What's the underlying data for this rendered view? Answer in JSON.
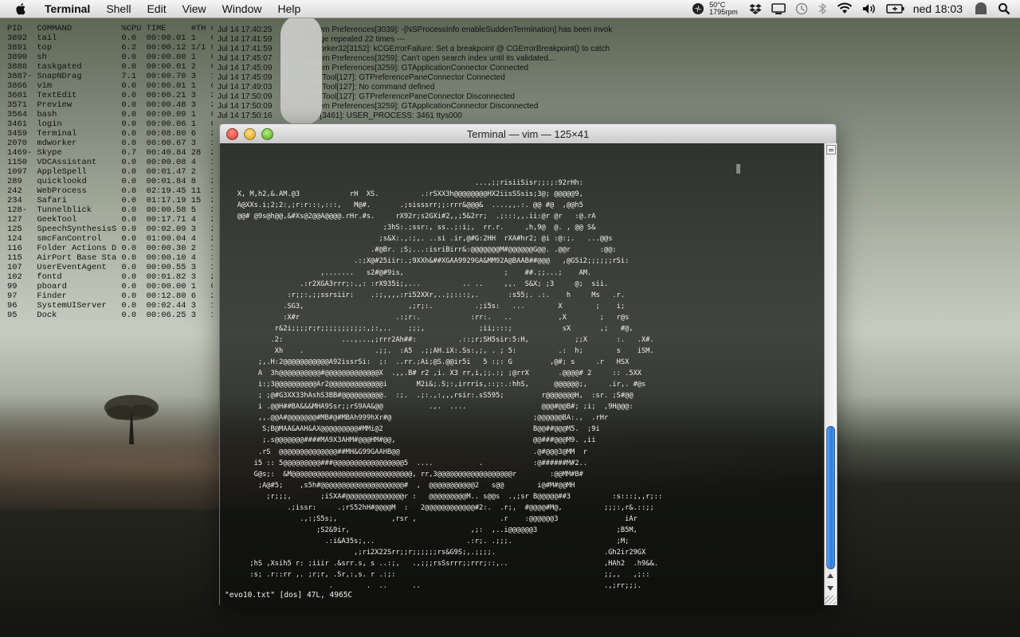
{
  "menubar": {
    "app_name": "Terminal",
    "items": [
      "Shell",
      "Edit",
      "View",
      "Window",
      "Help"
    ],
    "temp": "50°C",
    "rpm": "1795rpm",
    "clock": "ned 18:03",
    "icons": [
      "apple-icon",
      "cooling-icon",
      "dropbox-icon",
      "display-icon",
      "time-machine-icon",
      "bluetooth-icon",
      "wifi-icon",
      "volume-icon",
      "battery-icon",
      "user-icon",
      "spotlight-icon"
    ]
  },
  "process_list": {
    "text": "PID   COMMAND          %CPU TIME     #TH #WQ #POR\n3892  tail             0.0  00:00.01 1   0   14    22   1\n3891  top              6.2  00:00.12 1/1 0   25+   36+\n3890  sh               0.0  00:00.00 1   0   14    23   2\n3888  taskgated        0.0  00:00.01 2   0   25    27\n3887- SnapNDrag        7.1  00:00.70 3   1   101   1\n3866  vim              0.0  00:00.01 1   0   17    36\n3601  TextEdit         0.0  00:00.21 3   2   103   102\n3571  Preview          0.0  00:00.48 3   2   106   166\n3564  bash             0.0  00:00.09 1   0   17    24\n3461  login            0.0  00:00.06 1   0   22    56\n3459  Terminal         0.0  00:08.80 6   2   113   175\n2070  mdworker         0.0  00:00.67 3   1   50    83\n1469- Skype            0.7  00:40.84 28  2   427   793\n1150  VDCAssistant     0.0  00:00.08 4   1   90    74\n1097  AppleSpell       0.0  00:01.47 2   1   41    58\n289   quicklookd       0.0  00:01.84 8   2   102   155\n242   WebProcess       0.0  02:19.45 11  2   202   19\n234   Safari           0.0  01:17.19 15  2   288   827\n128-  Tunnelblick      0.0  00:00.58 5   2   107   12\n127   GeekTool         0.0  00:17.71 4   2   130   180\n125   SpeechSynthesisS 0.0  00:02.09 3   2   142   1\n124   smcFanControl    0.0  01:00.04 4   2   116   1\n116   Folder Actions D 0.0  00:00.30 2   1   67    80\n115   AirPort Base Sta 0.0  00:00.10 4   1   83    87\n107   UserEventAgent   0.0  00:00.55 3   1   181   1\n102   fontd            0.0  00:01.82 3   2   89    127\n99    pboard           0.0  00:00.00 1   0   22    39\n97    Finder           0.0  00:12.80 6   2   186   407\n96    SystemUIServer   0.0  00:02.44 3   1   248-  28\n95    Dock             0.0  00:06.25 3   1   135-  409-"
  },
  "console_log": {
    "text": "Jul 14 17:40:25              System Preferences[3039]: -[NSProcessInfo enableSuddenTermination] has been invok\nJul 14 17:41:59              essage repeated 22 times ---\nJul 14 17:41:59              mdworker32[3152]: kCGErrorFailure: Set a breakpoint @ CGErrorBreakpoint() to catch\nJul 14 17:45:07              System Preferences[3259]: Can't open search index until its validated...\nJul 14 17:45:09              System Preferences[3259]: GTApplicationConnector Connected\nJul 14 17:45:09              GeekTool[127]: GTPreferencePaneConnector Connected\nJul 14 17:49:03              GeekTool[127]: No command defined\nJul 14 17:50:09              GeekTool[127]: GTPreferencePaneConnector Disconnected\nJul 14 17:50:09              System Preferences[3259]: GTApplicationConnector Disconnected\nJul 14 17:50:16              login[3461]: USER_PROCESS: 3461 ttys000"
  },
  "terminal": {
    "title": "Terminal — vim — 125×41",
    "ascii_art": "                                                            ...,;;risiiSisr;;:;:92rHh:\n   X, M,h2,&.AM.@3            rH  XS.          .:rSXX3h@@@@@@@@HX2iisSSsis;3@; @@@@@9,\n   A@XXs.i;2;2:,;r:r:::,:::,   M@#.       .;sisssrr;;:rrr&@@@&  ....,,.:. @@ #@  ,@@h5\n   @@# @9s@h@@,&#Xs@2@@A@@@@.rHr.#s.     rX92r;s2GXi#2,,;5&2rr;  .;:::,,.ii:@r @r   :@.rA\n                                      ;3hS:.;ssr:, ss..;:i;,  rr.r.     ,h,9@  @. , @@ S&\n                                     ;s&X:.,:;,. ..si .ir,@#G:2HH  rXA#hr2; @i :@:;.   ...@@s\n                                   .#@Br. ;S;...:isriBirr&:@@@@@@@M#@@@@@@G@@. .@@r       :@@:\n                               .:;X@#25iir:.;9XXh&##XGAA9929GA&MM92A@BAAB##@@@   ,@GSi2;;;;;;rSi:\n                       ,.......   s2#@#9is,                        ;    ##.;;...;    AM.\n                  .:r2XGA3rrr;:.,: :rX935i;,...          .. ..     ,,.  S&X; ;3     @;  sii.\n               :r;;:,;;ssrsiir:    .:;,,,,:ri52XXr,..;;:::;,.       :s55;. .:.    h     Ms   .r.\n              .SG3,                         ,;r;:.          .;i5s:   ...        X        ;    i;\n              :X#r                       .:;r:.            :rr:.   ..           ,X        ;   r@s\n            r&2i;;;;r;r;;;;;;;;;;:,;:,..    ;;;,             ;ii;:::;            sX       ,;   #@,\n           .2:              ...,...,;rrr2Ah##:          .::;r;SH5sir:5:H,           ;;X       :.   .X#.\n            Xh    .                 .;;.  :A5  .;;AH.iX:.Ss:,;, . ; 5:          .:  h;        s    iSM.\n        ;,.H:2@@@@@@@@@@@A92issrSi:  ;:  ..rr.;Ai;@S.@@ir5i   5 :;: G         ,@#; s     .r   HSX\n        A  3h@@@@@@@@@@#@@@@@@@@@@@@@X  .,,.B# r2 ,i. X3 rr,i,;;.:; ;@rrX       .@@@@# 2     :: .5XX\n        i:;3@@@@@@@@@@Ar2@@@@@@@@@@@@@i       M2i&;.S;:,irrris,::;:.:hhS,      @@@@@@;,     .ir,. #@s\n        ; ;@#G3XX33hAshS3BB#@@@@@@@@@@.  :;.  .;:.,:,,,rsir:.sS595;         r@@@@@@@H,  :sr. ;S#@@\n        i .@@H##BA&&&MHA9Ssr;;rS9AA&@@           .,.  ....                  @@@#@@B#; ;i;  ,9H@@@:\n        ,,.@@A#@@@@@@@#MB#@#MBAh999hXr#@                                  ;@@@@@@BA:.,  .rHr\n         S;B@MAA&AAH&AX@@@@@@@@@#MMi@2                                    B@@##@@@M5.  ;9i\n         ;.s@@@@@@@####MA9X3AHM#@@@HM#@@,                                 @@###@@@M9. ,ii\n        .rS  @@@@@@@@@@@@@@##MH&G99GAAHB@@                                .@#@@@3@MM  r\n       i5 :: 5@@@@@@@@@###@@@@@@@@@@@@@@@@@5  ....           .            :@######M#2..\n       G@s;:  &M@@@@@@@@@@@@@@@@@@@@@@@@@@@@@, rr,3@@@@@@@@@@@@@@@@@@r        :@@MM#B#\n        ;A@#5;    ,s5h#@@@@@@@@@@@@@@@@@@@@#  ,  @@@@@@@@@@@2   s@@        i@#M#@@MH\n          ;r;;;,       ;iSXA#@@@@@@@@@@@@@@r :   @@@@@@@@@M.. s@@s  .,;sr B@@@@@##3          :s:::;,,r;::\n               .;issr:     .;rS52hH#@@@@M  :   2@@@@@@@@@@@@#2:.  .r;,  #@@@@#M@,          ;;;:,r&.::;;\n                  .,:;S5s;,             ,rsr ,                    .r    :@@@@@@3                iAr\n                      ;S2&9ir,                             ,;:  ,..i@@@@@@3                   ;B5M,\n                        .:i&A35s;,..                      .:r;. .;;;.                         ;M;\n                               ,;ri2X22Srr;;r;;;;;;rs&G9S;,.;;;;.                          .Gh2ir29GX\n      ;hS ,Xsih5 r: ;iiir .&srr.s, s ..:;,   .,;;;rsSsrrr;;rrr;::,..                       ,HAh2  .h9&&.\n      :s; .r::rr ,. ;r;r, .Sr,:,s. r .:;:                                                  ;;,,   ,;::\n                         .        .  ..      ..                                            .,;rr;;;.",
    "status_line": "\"evo10.txt\" [dos] 47L, 4965C"
  }
}
